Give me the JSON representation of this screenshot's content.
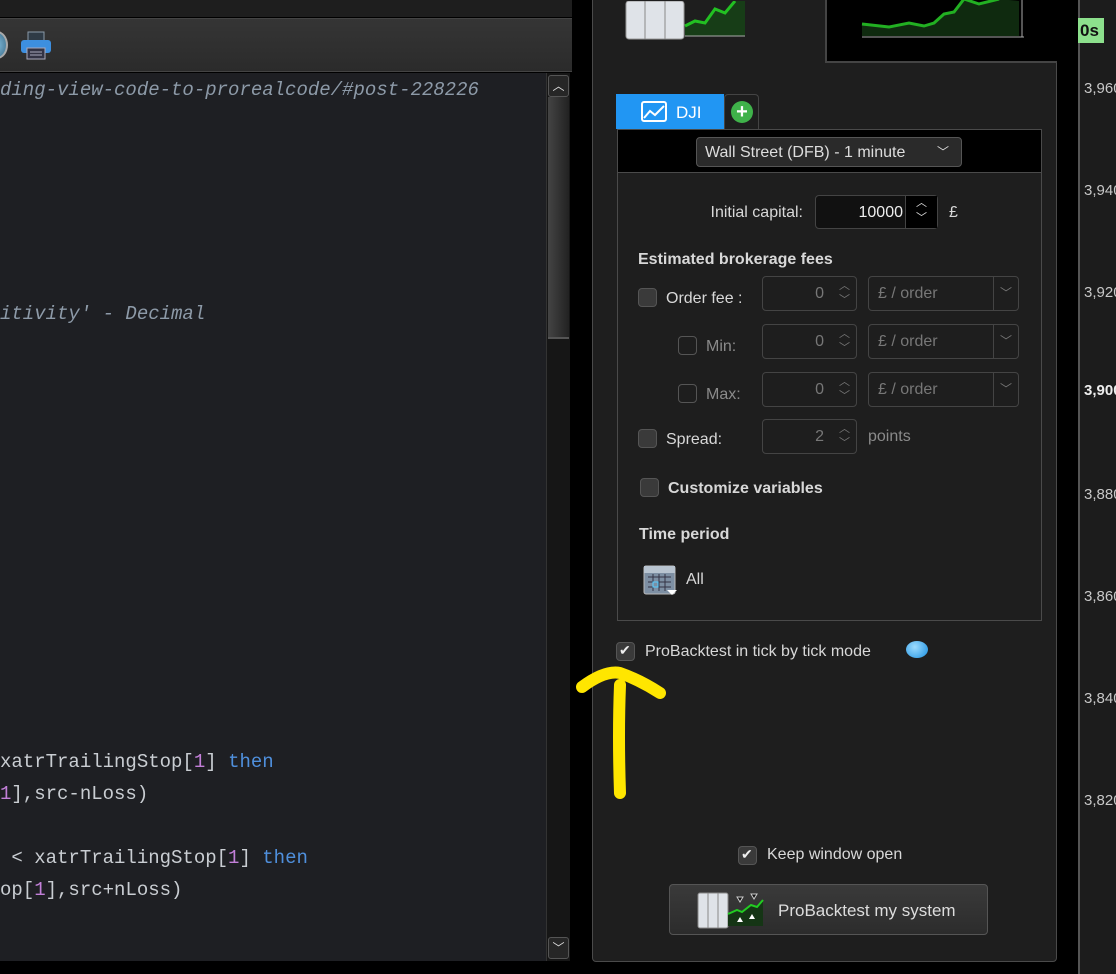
{
  "editor": {
    "lines": [
      {
        "comment": "ding-view-code-to-prorealcode/#post-228226"
      },
      {
        "comment": "itivity' - Decimal"
      },
      {
        "a": "xatrTrailingStop[",
        "n": "1",
        "b": "] ",
        "k": "then"
      },
      {
        "n": "1",
        "b": "],src-nLoss)"
      },
      {
        "a": " < xatrTrailingStop[",
        "n": "1",
        "b": "] ",
        "k": "then"
      },
      {
        "a": "op[",
        "n": "1",
        "b": "],src+nLoss)"
      }
    ]
  },
  "dialog": {
    "tab_label": "DJI",
    "instrument": "Wall Street (DFB) - 1 minute",
    "initial_capital_label": "Initial capital:",
    "initial_capital": "10000",
    "currency": "£",
    "fees_heading": "Estimated brokerage fees",
    "order_fee": {
      "label": "Order fee :",
      "value": "0",
      "unit": "£ / order",
      "checked": false
    },
    "min": {
      "label": "Min:",
      "value": "0",
      "unit": "£ / order",
      "checked": false
    },
    "max": {
      "label": "Max:",
      "value": "0",
      "unit": "£ / order",
      "checked": false
    },
    "spread": {
      "label": "Spread:",
      "value": "2",
      "unit": "points",
      "checked": false
    },
    "customize_label": "Customize variables",
    "time_period_heading": "Time period",
    "time_period_value": "All",
    "tick_mode_label": "ProBacktest in tick by tick mode",
    "tick_mode_checked": true,
    "keep_open_label": "Keep window open",
    "keep_open_checked": true,
    "run_button": "ProBacktest my system"
  },
  "price_axis": {
    "badge": "0s",
    "ticks": [
      "3,960",
      "3,940",
      "3,920",
      "3,900",
      "3,880",
      "3,860",
      "3,840",
      "3,820"
    ]
  },
  "colors": {
    "accent": "#2196f3",
    "annotation": "#ffe600",
    "badge": "#8de08d"
  }
}
